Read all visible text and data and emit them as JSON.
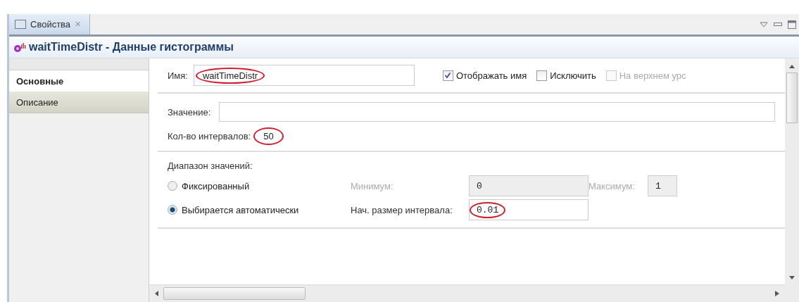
{
  "view_tab": {
    "title": "Свойства",
    "close": "✕"
  },
  "header": {
    "title": "waitTimeDistr - Данные гистограммы"
  },
  "sidebar": {
    "items": [
      {
        "label": "Основные",
        "selected": true
      },
      {
        "label": "Описание",
        "selected": false
      }
    ]
  },
  "name_row": {
    "label": "Имя:",
    "value": "waitTimeDistr",
    "circled": true,
    "checkboxes": [
      {
        "label": "Отображать имя",
        "checked": true,
        "disabled": false
      },
      {
        "label": "Исключить",
        "checked": false,
        "disabled": false
      },
      {
        "label": "На верхнем урс",
        "checked": false,
        "disabled": true
      }
    ]
  },
  "value_row": {
    "label": "Значение:"
  },
  "intervals": {
    "label": "Кол-во интервалов:",
    "value": "50",
    "circled": true
  },
  "range": {
    "label": "Диапазон значений:",
    "options": [
      {
        "label": "Фиксированный",
        "selected": false
      },
      {
        "label": "Выбирается автоматически",
        "selected": true
      }
    ],
    "fields": [
      {
        "label": "Минимум:",
        "value": "0",
        "disabled": true,
        "circled": false
      },
      {
        "label": "Максимум:",
        "value": "1",
        "disabled": true,
        "circled": false
      },
      {
        "label": "Нач. размер интервала:",
        "value": "0.01",
        "disabled": false,
        "circled": true
      }
    ]
  }
}
